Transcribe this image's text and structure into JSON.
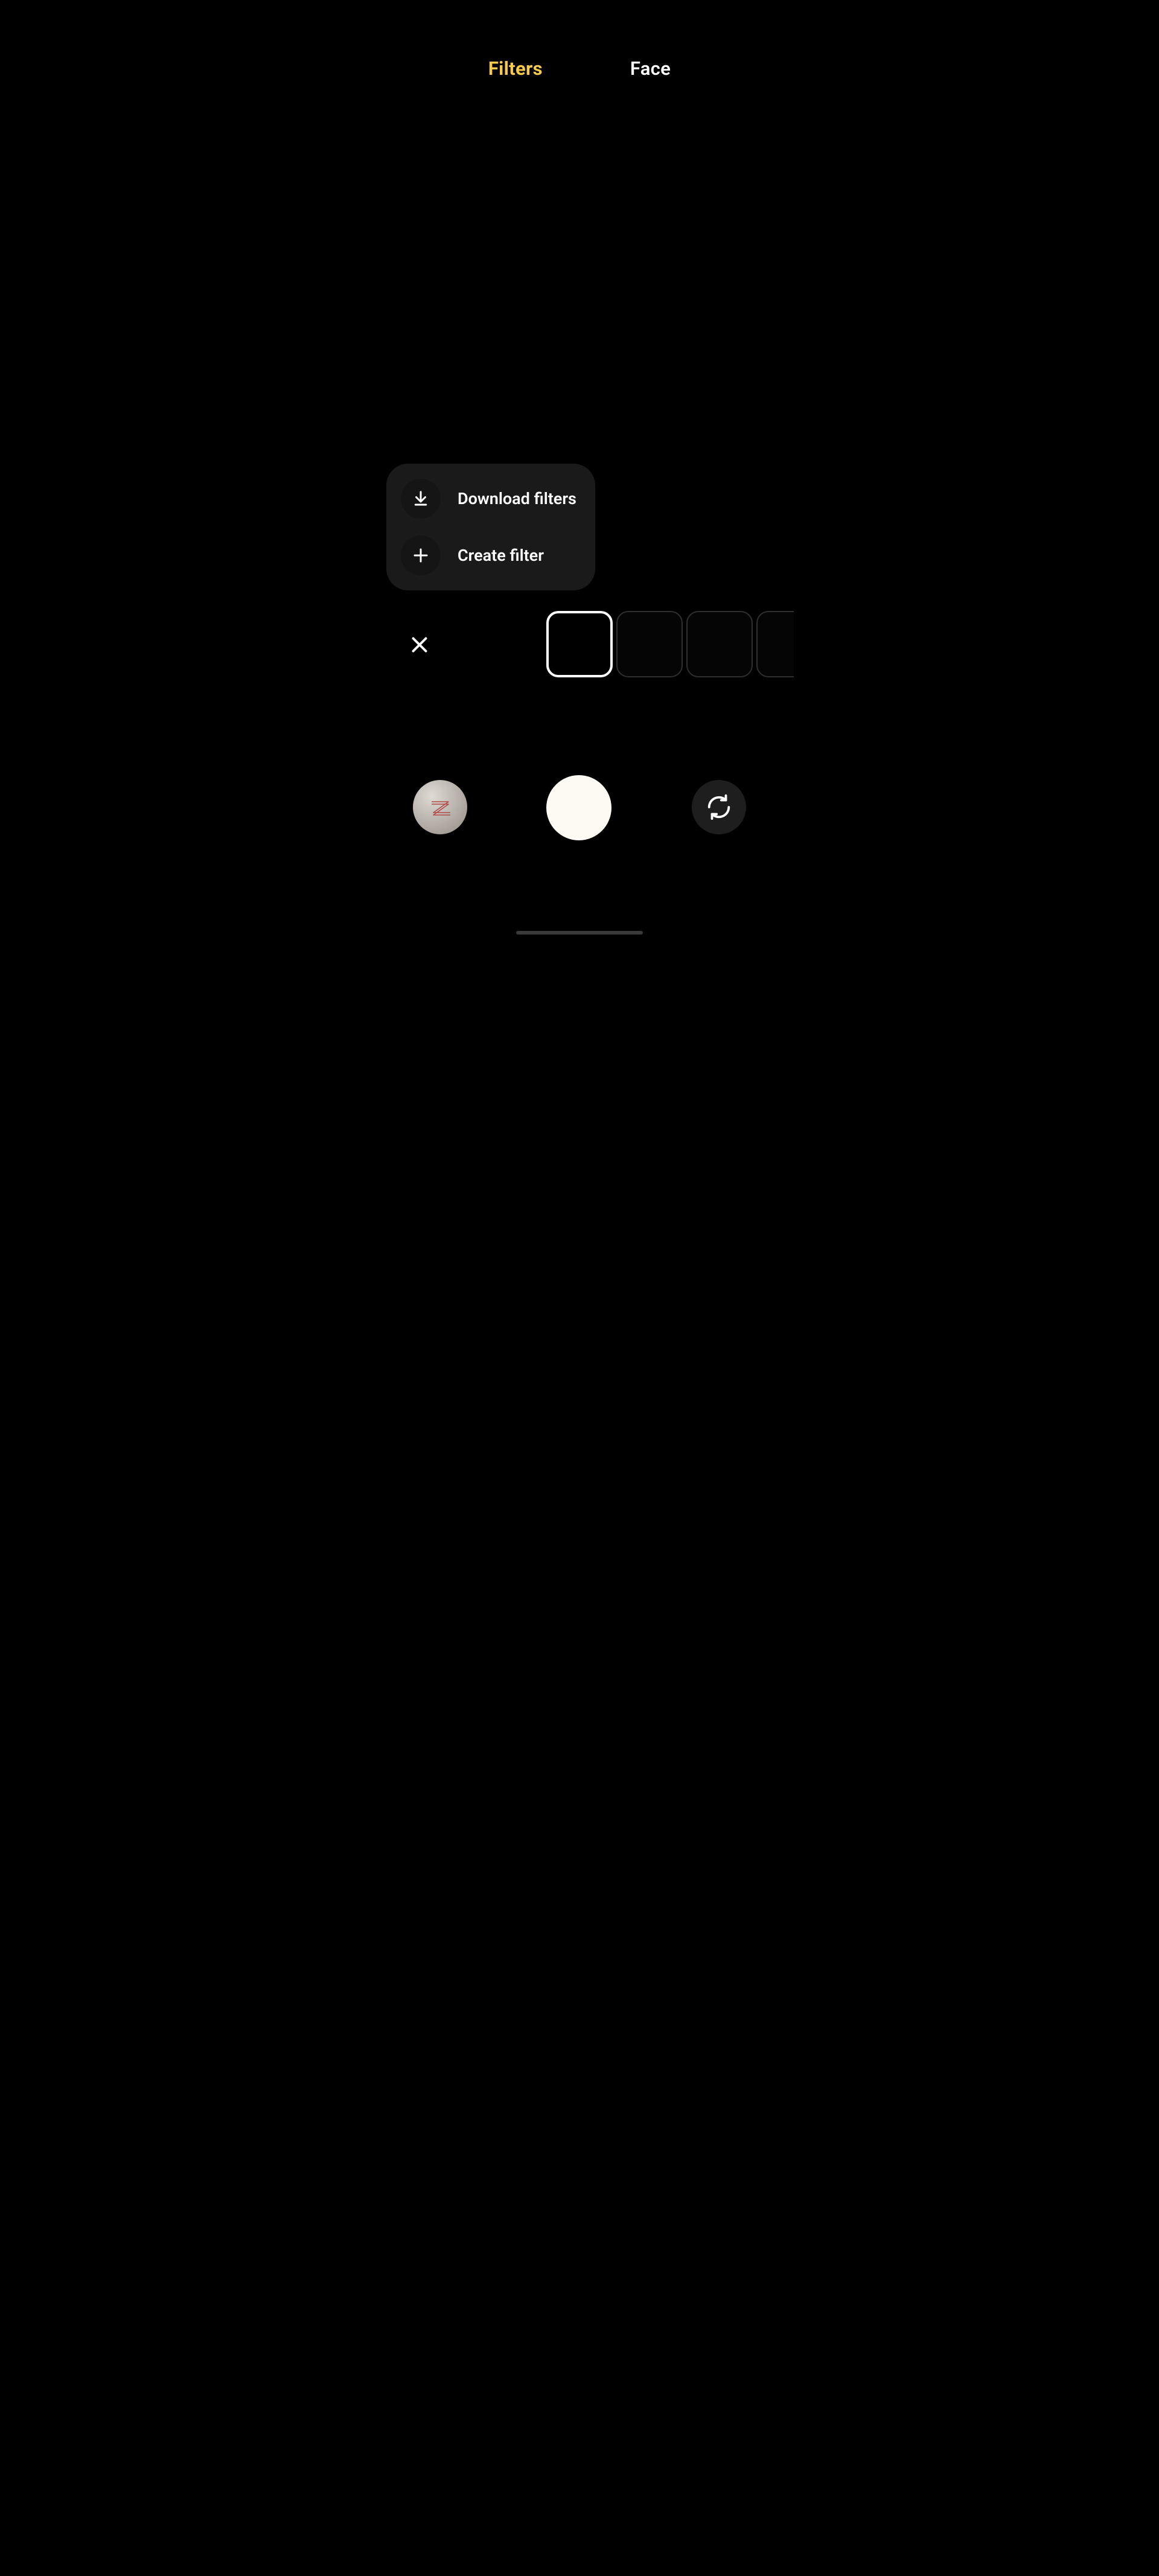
{
  "tabs": {
    "filters": "Filters",
    "face": "Face",
    "active": "filters"
  },
  "popover": {
    "download": {
      "label": "Download filters",
      "icon": "download-icon"
    },
    "create": {
      "label": "Create filter",
      "icon": "plus-icon"
    }
  },
  "filter_strip": {
    "items": [
      {
        "selected": true
      },
      {
        "selected": false
      },
      {
        "selected": false
      },
      {
        "selected": false,
        "cutoff": true
      }
    ]
  },
  "controls": {
    "close_icon": "close-icon",
    "shutter_icon": "shutter-icon",
    "switch_camera_icon": "switch-camera-icon",
    "gallery_thumb_glyph": "Z"
  },
  "colors": {
    "accent": "#f7c948",
    "background": "#000000"
  }
}
